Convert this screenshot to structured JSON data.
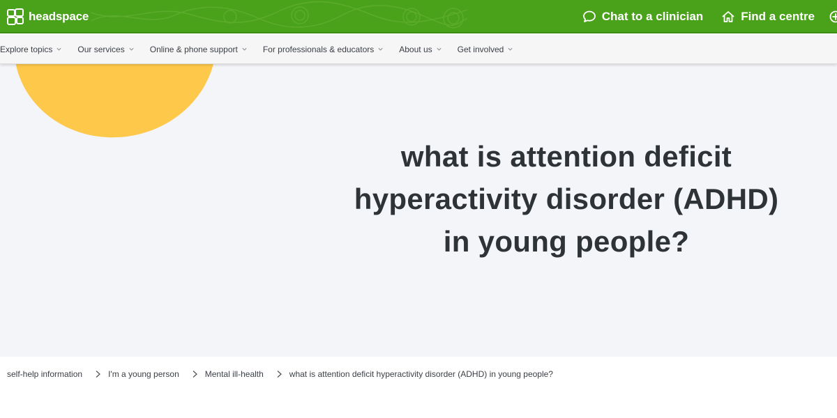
{
  "brand": {
    "name": "headspace",
    "primary_color": "#4aa11a",
    "accent_color": "#fec84a"
  },
  "header": {
    "actions": [
      {
        "label": "Chat to a clinician",
        "icon": "chat-bubble-icon"
      },
      {
        "label": "Find a centre",
        "icon": "home-icon"
      }
    ]
  },
  "nav": {
    "items": [
      {
        "label": "Explore topics"
      },
      {
        "label": "Our services"
      },
      {
        "label": "Online & phone support"
      },
      {
        "label": "For professionals & educators"
      },
      {
        "label": "About us"
      },
      {
        "label": "Get involved"
      }
    ]
  },
  "hero": {
    "title": "what is attention deficit hyperactivity disorder (ADHD) in young people?"
  },
  "breadcrumb": {
    "items": [
      "self-help information",
      "I'm a young person",
      "Mental ill-health",
      "what is attention deficit hyperactivity disorder (ADHD) in young people?"
    ]
  }
}
